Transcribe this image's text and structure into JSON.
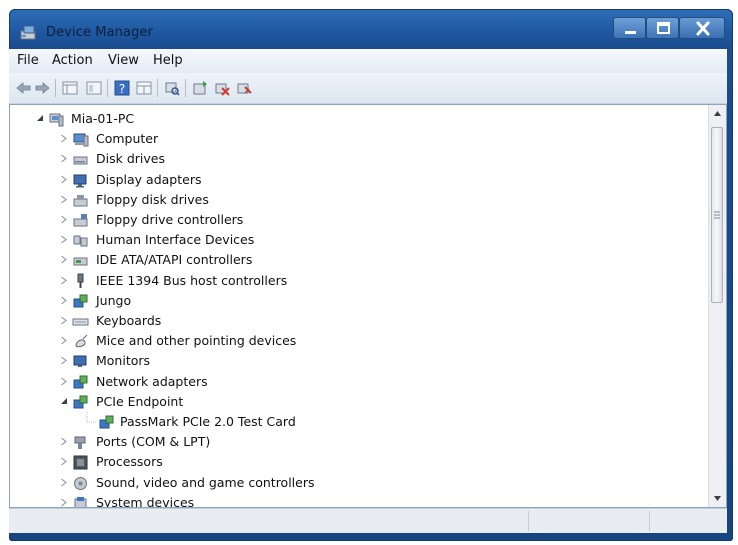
{
  "window": {
    "title": "Device Manager"
  },
  "menu": [
    "File",
    "Action",
    "View",
    "Help"
  ],
  "toolbar": [
    "back-arrow-icon",
    "forward-arrow-icon",
    "properties-icon",
    "console-tree-icon",
    "help-icon",
    "view-icon",
    "scan-hardware-icon",
    "update-driver-icon",
    "uninstall-icon",
    "disable-icon"
  ],
  "tree": {
    "root": "Mia-01-PC",
    "items": [
      {
        "label": "Computer",
        "icon": "computer-icon"
      },
      {
        "label": "Disk drives",
        "icon": "disk-drive-icon"
      },
      {
        "label": "Display adapters",
        "icon": "display-adapter-icon"
      },
      {
        "label": "Floppy disk drives",
        "icon": "floppy-disk-icon"
      },
      {
        "label": "Floppy drive controllers",
        "icon": "floppy-controller-icon"
      },
      {
        "label": "Human Interface Devices",
        "icon": "hid-icon"
      },
      {
        "label": "IDE ATA/ATAPI controllers",
        "icon": "ide-controller-icon"
      },
      {
        "label": "IEEE 1394 Bus host controllers",
        "icon": "ieee1394-icon"
      },
      {
        "label": "Jungo",
        "icon": "device-icon"
      },
      {
        "label": "Keyboards",
        "icon": "keyboard-icon"
      },
      {
        "label": "Mice and other pointing devices",
        "icon": "mouse-icon"
      },
      {
        "label": "Monitors",
        "icon": "monitor-icon"
      },
      {
        "label": "Network adapters",
        "icon": "network-icon"
      },
      {
        "label": "PCIe Endpoint",
        "icon": "device-icon",
        "expanded": true,
        "children": [
          {
            "label": "PassMark PCIe 2.0 Test Card",
            "icon": "device-icon"
          }
        ]
      },
      {
        "label": "Ports (COM & LPT)",
        "icon": "port-icon"
      },
      {
        "label": "Processors",
        "icon": "processor-icon"
      },
      {
        "label": "Sound, video and game controllers",
        "icon": "sound-icon"
      },
      {
        "label": "System devices",
        "icon": "system-icon"
      }
    ]
  },
  "colors": {
    "titlebar": "#1e57a0",
    "menubar": "#eef3f9",
    "selection": "#3d72b5"
  }
}
